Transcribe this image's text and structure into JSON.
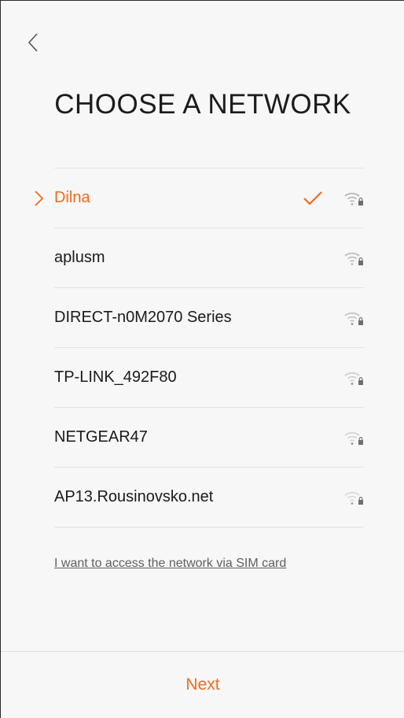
{
  "header": {
    "title": "CHOOSE A NETWORK"
  },
  "networks": [
    {
      "name": "Dilna",
      "selected": true,
      "connected": true
    },
    {
      "name": "aplusm",
      "selected": false,
      "connected": false
    },
    {
      "name": "DIRECT-n0M2070 Series",
      "selected": false,
      "connected": false
    },
    {
      "name": "TP-LINK_492F80",
      "selected": false,
      "connected": false
    },
    {
      "name": "NETGEAR47",
      "selected": false,
      "connected": false
    },
    {
      "name": "AP13.Rousinovsko.net",
      "selected": false,
      "connected": false
    }
  ],
  "sim_link": "I want to access the network via SIM card",
  "footer": {
    "next_label": "Next"
  },
  "colors": {
    "accent": "#f26a1b",
    "text": "#1a1a1a",
    "background": "#f7f7f7"
  }
}
